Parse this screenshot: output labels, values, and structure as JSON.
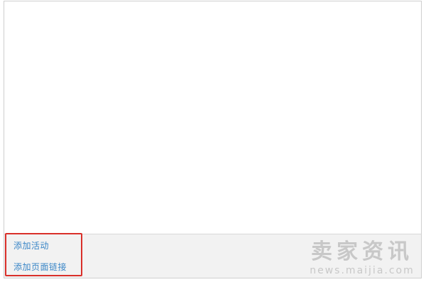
{
  "footer": {
    "links": [
      {
        "label": "添加活动"
      },
      {
        "label": "添加页面链接"
      }
    ]
  },
  "watermark": {
    "title": "卖家资讯",
    "url": "news.maijia.com"
  },
  "colors": {
    "link": "#3a86c7",
    "highlight_border": "#d9302a",
    "footer_bg": "#f2f2f2",
    "frame_border": "#cfcfcf"
  }
}
